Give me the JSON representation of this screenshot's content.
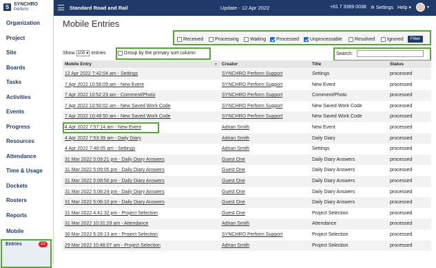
{
  "topbar": {
    "logo_mark": "S",
    "logo_title": "SYNCHRO",
    "logo_sub": "Perform",
    "project": "Standard Road and Rail",
    "update": "Update - 12 Apr 2022",
    "phone": "+61 7 3369 0038",
    "settings": "Settings",
    "help": "Help",
    "help_caret": "▾",
    "avatar_caret": "▾"
  },
  "sidebar": {
    "items": [
      "Organization",
      "Project",
      "Site",
      "Boards",
      "Tasks",
      "Activities",
      "Events",
      "Progress",
      "Resources",
      "Attendance",
      "Time & Usage",
      "Dockets",
      "Rosters",
      "Reports",
      "Mobile"
    ],
    "entries_label": "Entries",
    "entries_badge": "22"
  },
  "page": {
    "title": "Mobile Entries"
  },
  "filters": {
    "options": [
      {
        "label": "Received",
        "checked": false
      },
      {
        "label": "Processing",
        "checked": false
      },
      {
        "label": "Waiting",
        "checked": false
      },
      {
        "label": "Processed",
        "checked": true
      },
      {
        "label": "Unprocessable",
        "checked": true
      },
      {
        "label": "Resolved",
        "checked": false
      },
      {
        "label": "Ignored",
        "checked": false
      }
    ],
    "button": "Filter"
  },
  "controls": {
    "show_label": "Show",
    "show_value": "100",
    "entries_label": "entries",
    "group_label": "Group by the primary sort column",
    "search_label": "Search:",
    "search_value": ""
  },
  "table": {
    "columns": [
      "Mobile Entry",
      "Creator",
      "Title",
      "Status"
    ],
    "sort_indicator": "▼",
    "rows": [
      [
        "12 Apr 2022 7:42:04 am - Settings",
        "SYNCHRO Perform Support",
        "Settings",
        "processed"
      ],
      [
        "7 Apr 2022 10:56:09 am - New Event",
        "SYNCHRO Perform Support",
        "New Event",
        "processed"
      ],
      [
        "7 Apr 2022 10:52:23 am - Comment/Photo",
        "SYNCHRO Perform Support",
        "Comment/Photo",
        "processed"
      ],
      [
        "7 Apr 2022 10:50:02 am - New Saved Work Code",
        "SYNCHRO Perform Support",
        "New Saved Work Code",
        "processed"
      ],
      [
        "7 Apr 2022 10:49:50 am - New Saved Work Code",
        "SYNCHRO Perform Support",
        "New Saved Work Code",
        "processed"
      ],
      [
        "4 Apr 2022 7:57:14 am - New Event",
        "Adrian Smith",
        "New Event",
        "processed"
      ],
      [
        "4 Apr 2022 7:53:39 am - Daily Diary",
        "Adrian Smith",
        "Daily Diary",
        "processed"
      ],
      [
        "4 Apr 2022 7:48:05 am - Settings",
        "Adrian Smith",
        "Settings",
        "processed"
      ],
      [
        "31 Mar 2022 5:09:21 pm - Daily Diary Answers",
        "Guest One",
        "Daily Diary Answers",
        "processed"
      ],
      [
        "31 Mar 2022 5:09:05 pm - Daily Diary Answers",
        "Guest One",
        "Daily Diary Answers",
        "processed"
      ],
      [
        "31 Mar 2022 5:08:50 pm - Daily Diary Answers",
        "Guest One",
        "Daily Diary Answers",
        "processed"
      ],
      [
        "31 Mar 2022 5:08:24 pm - Daily Diary Answers",
        "Guest One",
        "Daily Diary Answers",
        "processed"
      ],
      [
        "31 Mar 2022 5:08:10 pm - Daily Diary Answers",
        "Guest One",
        "Daily Diary Answers",
        "processed"
      ],
      [
        "31 Mar 2022 4:41:32 pm - Project Selection",
        "Guest One",
        "Project Selection",
        "processed"
      ],
      [
        "31 Mar 2022 10:31:29 am - Attendance",
        "Adrian Smith",
        "Attendance",
        "processed"
      ],
      [
        "30 Mar 2022 6:28:13 am - Project Selection",
        "SYNCHRO Perform Support",
        "Project Selection",
        "processed"
      ],
      [
        "29 Mar 2022 10:48:07 am - Project Selection",
        "Adrian Smith",
        "Project Selection",
        "processed"
      ]
    ]
  }
}
